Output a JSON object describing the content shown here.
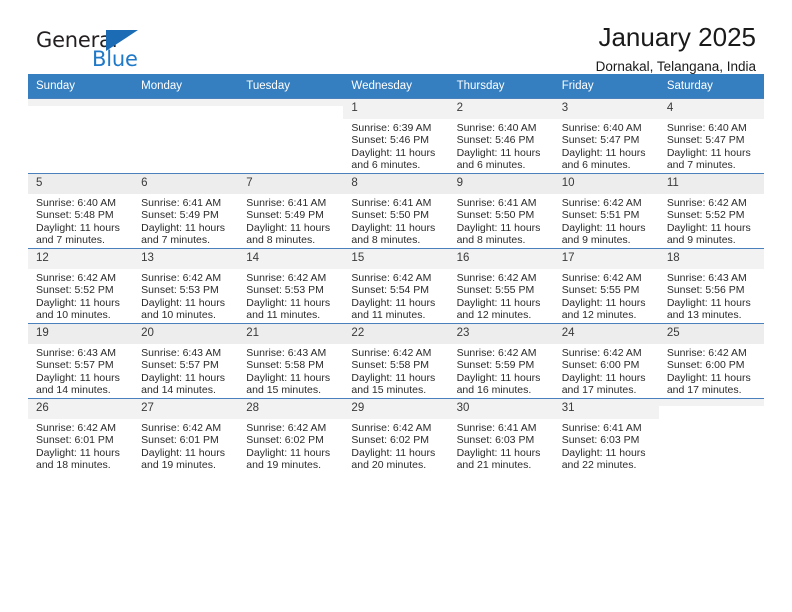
{
  "brand": {
    "name_top": "General",
    "name_bottom": "Blue",
    "accent_color": "#2079c7",
    "triangle_color": "#1b6cb5"
  },
  "header": {
    "title": "January 2025",
    "subtitle": "Dornakal, Telangana, India"
  },
  "theme": {
    "header_row_bg": "#357ec0",
    "header_row_text": "#ffffff",
    "cell_border": "#4a81bd",
    "daynum_bg": "#f2f2f2",
    "daynum_bg_shaded": "#ededed"
  },
  "weekday_headers": [
    "Sunday",
    "Monday",
    "Tuesday",
    "Wednesday",
    "Thursday",
    "Friday",
    "Saturday"
  ],
  "labels": {
    "sunrise_prefix": "Sunrise:",
    "sunset_prefix": "Sunset:",
    "daylight_prefix": "Daylight:"
  },
  "weeks": [
    {
      "shaded": false,
      "days": [
        {
          "num": "",
          "empty": true,
          "sunrise": "",
          "sunset": "",
          "daylight_line1": "",
          "daylight_line2": ""
        },
        {
          "num": "",
          "empty": true,
          "sunrise": "",
          "sunset": "",
          "daylight_line1": "",
          "daylight_line2": ""
        },
        {
          "num": "",
          "empty": true,
          "sunrise": "",
          "sunset": "",
          "daylight_line1": "",
          "daylight_line2": ""
        },
        {
          "num": "1",
          "empty": false,
          "sunrise": "Sunrise: 6:39 AM",
          "sunset": "Sunset: 5:46 PM",
          "daylight_line1": "Daylight: 11 hours",
          "daylight_line2": "and 6 minutes."
        },
        {
          "num": "2",
          "empty": false,
          "sunrise": "Sunrise: 6:40 AM",
          "sunset": "Sunset: 5:46 PM",
          "daylight_line1": "Daylight: 11 hours",
          "daylight_line2": "and 6 minutes."
        },
        {
          "num": "3",
          "empty": false,
          "sunrise": "Sunrise: 6:40 AM",
          "sunset": "Sunset: 5:47 PM",
          "daylight_line1": "Daylight: 11 hours",
          "daylight_line2": "and 6 minutes."
        },
        {
          "num": "4",
          "empty": false,
          "sunrise": "Sunrise: 6:40 AM",
          "sunset": "Sunset: 5:47 PM",
          "daylight_line1": "Daylight: 11 hours",
          "daylight_line2": "and 7 minutes."
        }
      ]
    },
    {
      "shaded": true,
      "days": [
        {
          "num": "5",
          "empty": false,
          "sunrise": "Sunrise: 6:40 AM",
          "sunset": "Sunset: 5:48 PM",
          "daylight_line1": "Daylight: 11 hours",
          "daylight_line2": "and 7 minutes."
        },
        {
          "num": "6",
          "empty": false,
          "sunrise": "Sunrise: 6:41 AM",
          "sunset": "Sunset: 5:49 PM",
          "daylight_line1": "Daylight: 11 hours",
          "daylight_line2": "and 7 minutes."
        },
        {
          "num": "7",
          "empty": false,
          "sunrise": "Sunrise: 6:41 AM",
          "sunset": "Sunset: 5:49 PM",
          "daylight_line1": "Daylight: 11 hours",
          "daylight_line2": "and 8 minutes."
        },
        {
          "num": "8",
          "empty": false,
          "sunrise": "Sunrise: 6:41 AM",
          "sunset": "Sunset: 5:50 PM",
          "daylight_line1": "Daylight: 11 hours",
          "daylight_line2": "and 8 minutes."
        },
        {
          "num": "9",
          "empty": false,
          "sunrise": "Sunrise: 6:41 AM",
          "sunset": "Sunset: 5:50 PM",
          "daylight_line1": "Daylight: 11 hours",
          "daylight_line2": "and 8 minutes."
        },
        {
          "num": "10",
          "empty": false,
          "sunrise": "Sunrise: 6:42 AM",
          "sunset": "Sunset: 5:51 PM",
          "daylight_line1": "Daylight: 11 hours",
          "daylight_line2": "and 9 minutes."
        },
        {
          "num": "11",
          "empty": false,
          "sunrise": "Sunrise: 6:42 AM",
          "sunset": "Sunset: 5:52 PM",
          "daylight_line1": "Daylight: 11 hours",
          "daylight_line2": "and 9 minutes."
        }
      ]
    },
    {
      "shaded": false,
      "days": [
        {
          "num": "12",
          "empty": false,
          "sunrise": "Sunrise: 6:42 AM",
          "sunset": "Sunset: 5:52 PM",
          "daylight_line1": "Daylight: 11 hours",
          "daylight_line2": "and 10 minutes."
        },
        {
          "num": "13",
          "empty": false,
          "sunrise": "Sunrise: 6:42 AM",
          "sunset": "Sunset: 5:53 PM",
          "daylight_line1": "Daylight: 11 hours",
          "daylight_line2": "and 10 minutes."
        },
        {
          "num": "14",
          "empty": false,
          "sunrise": "Sunrise: 6:42 AM",
          "sunset": "Sunset: 5:53 PM",
          "daylight_line1": "Daylight: 11 hours",
          "daylight_line2": "and 11 minutes."
        },
        {
          "num": "15",
          "empty": false,
          "sunrise": "Sunrise: 6:42 AM",
          "sunset": "Sunset: 5:54 PM",
          "daylight_line1": "Daylight: 11 hours",
          "daylight_line2": "and 11 minutes."
        },
        {
          "num": "16",
          "empty": false,
          "sunrise": "Sunrise: 6:42 AM",
          "sunset": "Sunset: 5:55 PM",
          "daylight_line1": "Daylight: 11 hours",
          "daylight_line2": "and 12 minutes."
        },
        {
          "num": "17",
          "empty": false,
          "sunrise": "Sunrise: 6:42 AM",
          "sunset": "Sunset: 5:55 PM",
          "daylight_line1": "Daylight: 11 hours",
          "daylight_line2": "and 12 minutes."
        },
        {
          "num": "18",
          "empty": false,
          "sunrise": "Sunrise: 6:43 AM",
          "sunset": "Sunset: 5:56 PM",
          "daylight_line1": "Daylight: 11 hours",
          "daylight_line2": "and 13 minutes."
        }
      ]
    },
    {
      "shaded": true,
      "days": [
        {
          "num": "19",
          "empty": false,
          "sunrise": "Sunrise: 6:43 AM",
          "sunset": "Sunset: 5:57 PM",
          "daylight_line1": "Daylight: 11 hours",
          "daylight_line2": "and 14 minutes."
        },
        {
          "num": "20",
          "empty": false,
          "sunrise": "Sunrise: 6:43 AM",
          "sunset": "Sunset: 5:57 PM",
          "daylight_line1": "Daylight: 11 hours",
          "daylight_line2": "and 14 minutes."
        },
        {
          "num": "21",
          "empty": false,
          "sunrise": "Sunrise: 6:43 AM",
          "sunset": "Sunset: 5:58 PM",
          "daylight_line1": "Daylight: 11 hours",
          "daylight_line2": "and 15 minutes."
        },
        {
          "num": "22",
          "empty": false,
          "sunrise": "Sunrise: 6:42 AM",
          "sunset": "Sunset: 5:58 PM",
          "daylight_line1": "Daylight: 11 hours",
          "daylight_line2": "and 15 minutes."
        },
        {
          "num": "23",
          "empty": false,
          "sunrise": "Sunrise: 6:42 AM",
          "sunset": "Sunset: 5:59 PM",
          "daylight_line1": "Daylight: 11 hours",
          "daylight_line2": "and 16 minutes."
        },
        {
          "num": "24",
          "empty": false,
          "sunrise": "Sunrise: 6:42 AM",
          "sunset": "Sunset: 6:00 PM",
          "daylight_line1": "Daylight: 11 hours",
          "daylight_line2": "and 17 minutes."
        },
        {
          "num": "25",
          "empty": false,
          "sunrise": "Sunrise: 6:42 AM",
          "sunset": "Sunset: 6:00 PM",
          "daylight_line1": "Daylight: 11 hours",
          "daylight_line2": "and 17 minutes."
        }
      ]
    },
    {
      "shaded": false,
      "days": [
        {
          "num": "26",
          "empty": false,
          "sunrise": "Sunrise: 6:42 AM",
          "sunset": "Sunset: 6:01 PM",
          "daylight_line1": "Daylight: 11 hours",
          "daylight_line2": "and 18 minutes."
        },
        {
          "num": "27",
          "empty": false,
          "sunrise": "Sunrise: 6:42 AM",
          "sunset": "Sunset: 6:01 PM",
          "daylight_line1": "Daylight: 11 hours",
          "daylight_line2": "and 19 minutes."
        },
        {
          "num": "28",
          "empty": false,
          "sunrise": "Sunrise: 6:42 AM",
          "sunset": "Sunset: 6:02 PM",
          "daylight_line1": "Daylight: 11 hours",
          "daylight_line2": "and 19 minutes."
        },
        {
          "num": "29",
          "empty": false,
          "sunrise": "Sunrise: 6:42 AM",
          "sunset": "Sunset: 6:02 PM",
          "daylight_line1": "Daylight: 11 hours",
          "daylight_line2": "and 20 minutes."
        },
        {
          "num": "30",
          "empty": false,
          "sunrise": "Sunrise: 6:41 AM",
          "sunset": "Sunset: 6:03 PM",
          "daylight_line1": "Daylight: 11 hours",
          "daylight_line2": "and 21 minutes."
        },
        {
          "num": "31",
          "empty": false,
          "sunrise": "Sunrise: 6:41 AM",
          "sunset": "Sunset: 6:03 PM",
          "daylight_line1": "Daylight: 11 hours",
          "daylight_line2": "and 22 minutes."
        },
        {
          "num": "",
          "empty": true,
          "sunrise": "",
          "sunset": "",
          "daylight_line1": "",
          "daylight_line2": ""
        }
      ]
    }
  ]
}
